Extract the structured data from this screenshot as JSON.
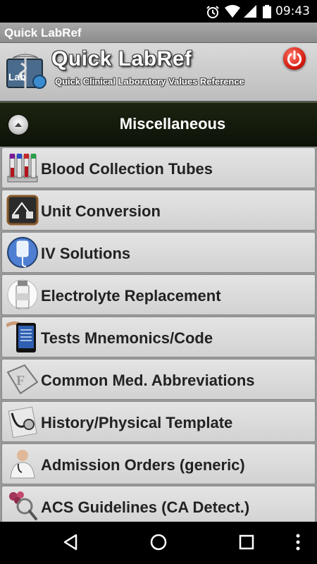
{
  "status_bar": {
    "time": "09:43",
    "icons": [
      "alarm-icon",
      "wifi-icon",
      "signal-icon",
      "battery-icon"
    ]
  },
  "app_bar": {
    "title": "Quick LabRef"
  },
  "header": {
    "logo_text": "Lab",
    "title": "Quick LabRef",
    "subtitle": "Quick Clinical Laboratory Values Reference",
    "power_icon": "power-icon"
  },
  "section": {
    "title": "Miscellaneous",
    "toggle_icon": "collapse-up-icon"
  },
  "menu": {
    "items": [
      {
        "label": "Blood Collection Tubes",
        "icon": "blood-tubes-icon"
      },
      {
        "label": "Unit Conversion",
        "icon": "scale-icon"
      },
      {
        "label": "IV Solutions",
        "icon": "iv-bag-icon"
      },
      {
        "label": "Electrolyte Replacement",
        "icon": "vial-icon"
      },
      {
        "label": "Tests Mnemonics/Code",
        "icon": "tablet-icon"
      },
      {
        "label": "Common Med. Abbreviations",
        "icon": "abbreviation-icon"
      },
      {
        "label": "History/Physical Template",
        "icon": "stethoscope-icon"
      },
      {
        "label": "Admission Orders (generic)",
        "icon": "doctor-icon"
      },
      {
        "label": "ACS Guidelines (CA Detect.)",
        "icon": "magnifier-icon"
      }
    ]
  },
  "nav_bar": {
    "icons": [
      "back-icon",
      "home-icon",
      "recents-icon",
      "overflow-menu-icon"
    ]
  },
  "colors": {
    "section_bg": "#141b0c",
    "power": "#d3170c"
  }
}
